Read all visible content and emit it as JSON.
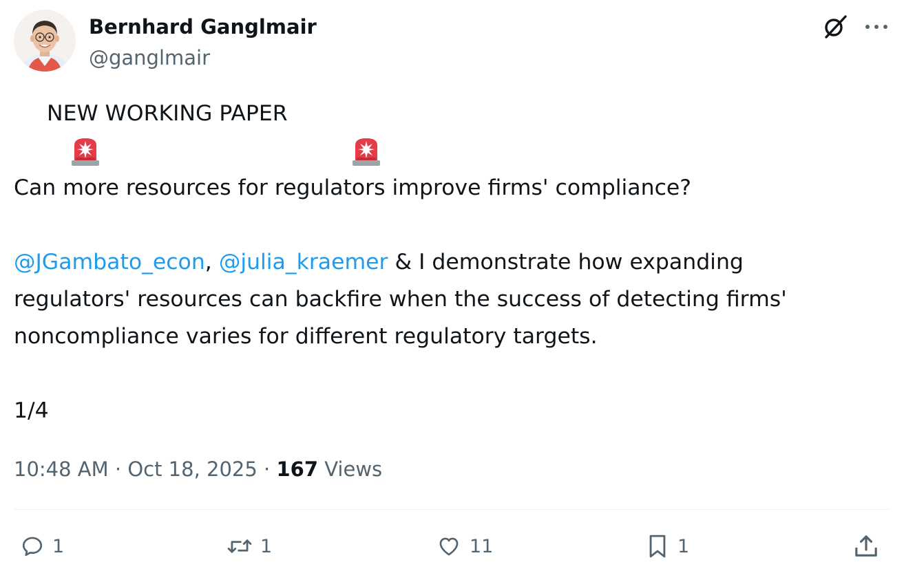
{
  "author": {
    "name": "Bernhard Ganglmair",
    "handle": "@ganglmair"
  },
  "header_icons": [
    "grok-icon",
    "more-icon"
  ],
  "tweet": {
    "headline": "NEW WORKING PAPER ",
    "headline_icon": "police-car-light-emoji",
    "question": "Can more resources for regulators improve firms' compliance?",
    "mention1": "@JGambato_econ",
    "sep": ", ",
    "mention2": "@julia_kraemer",
    "line3_rest": " & I demonstrate how expanding",
    "line4": "regulators' resources can backfire when the success of detecting firms'",
    "line5": "noncompliance varies for different regulatory targets.",
    "thread_marker": "1/4"
  },
  "meta": {
    "time": "10:48 AM",
    "date": "Oct 18, 2025",
    "separator": " · ",
    "views_count": "167",
    "views_label": "Views"
  },
  "actions": {
    "replies": "1",
    "reposts": "1",
    "likes": "11",
    "bookmarks": "1"
  },
  "colors": {
    "text": "#0f1419",
    "secondary": "#536471",
    "link": "#1d9bf0",
    "divider": "#eff3f4"
  }
}
